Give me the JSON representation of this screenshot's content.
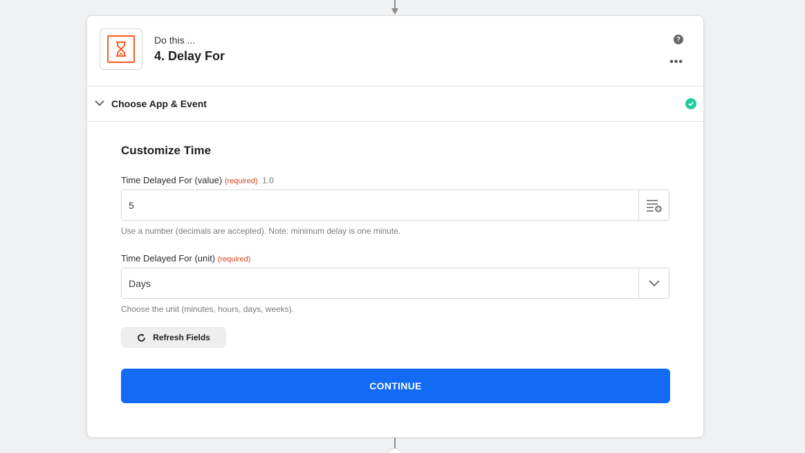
{
  "step": {
    "overline": "Do this ...",
    "title": "4. Delay For",
    "help_icon": "question-circle-icon",
    "more_icon": "more-horizontal-icon",
    "app_icon": "hourglass-icon",
    "accent_color": "#ff5a1f"
  },
  "section": {
    "label": "Choose App & Event",
    "status_icon": "check-circle-icon",
    "status_color": "#1fcc9b"
  },
  "form": {
    "title": "Customize Time",
    "fields": [
      {
        "label": "Time Delayed For (value)",
        "required_text": "(required)",
        "version": "1.0",
        "value": "5",
        "help": "Use a number (decimals are accepted). Note: minimum delay is one minute.",
        "addon_icon": "insert-data-icon"
      },
      {
        "label": "Time Delayed For (unit)",
        "required_text": "(required)",
        "value": "Days",
        "help": "Choose the unit (minutes, hours, days, weeks).",
        "addon_icon": "chevron-down-icon"
      }
    ],
    "refresh_label": "Refresh Fields",
    "continue_label": "CONTINUE",
    "primary_color": "#136bf5"
  }
}
